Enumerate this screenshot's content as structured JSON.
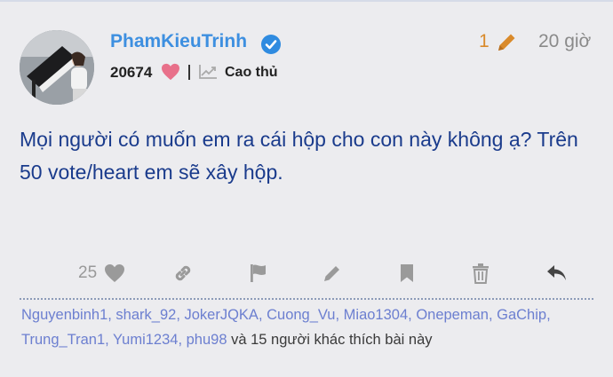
{
  "post": {
    "author": {
      "username": "PhamKieuTrinh",
      "likes_received": "20674",
      "rank": "Cao thủ",
      "verified": true
    },
    "edit_count": "1",
    "time_ago": "20 giờ",
    "content": "Mọi người có muốn em ra cái hộp cho con này không ạ? Trên 50 vote/heart em sẽ xây hộp.",
    "like_count": "25"
  },
  "actions": [
    "heart-icon",
    "link-icon",
    "flag-icon",
    "pencil-icon",
    "bookmark-icon",
    "trash-icon",
    "reply-icon"
  ],
  "likers": {
    "names": [
      "Nguyenbinh1",
      "shark_92",
      "JokerJQKA",
      "Cuong_Vu",
      "Miao1304",
      "Onepeman",
      "GaChip",
      "Trung_Tran1",
      "Yumi1234",
      "phu98"
    ],
    "suffix": "và 15 người khác thích bài này"
  },
  "colors": {
    "username": "#3d8fe0",
    "content": "#1a3b8c",
    "liker_link": "#6c7fd0",
    "edit_accent": "#d98a2b",
    "heart_pink": "#e8708a",
    "verified_blue": "#2f8be0",
    "icon_gray": "#9a9a9a",
    "background": "#ececef"
  }
}
